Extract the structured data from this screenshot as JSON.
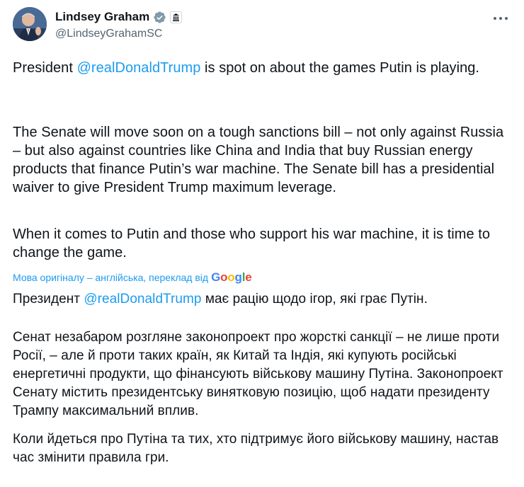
{
  "author": {
    "display_name": "Lindsey Graham",
    "handle": "@LindseyGrahamSC",
    "verified_icon": "verified-badge-icon",
    "affiliation_icon": "government-affiliation-icon"
  },
  "more_menu": {
    "icon": "more-options-icon"
  },
  "original": {
    "p1_before": "President ",
    "p1_mention": "@realDonaldTrump",
    "p1_after": " is spot on about the games Putin is playing.",
    "p2": "The Senate will move soon on a tough sanctions bill – not only against Russia – but also against countries like China and India that buy Russian energy products that finance Putin’s war machine. The Senate bill has a presidential waiver to give President Trump maximum leverage.",
    "p3": "When it comes to Putin and those who support his war machine, it is time to change the game."
  },
  "translation_note": {
    "label": "Мова оригіналу – англійська, переклад від",
    "provider": "Google"
  },
  "translated": {
    "p1_before": "Президент ",
    "p1_mention": "@realDonaldTrump",
    "p1_after": " має рацію щодо ігор, які грає Путін.",
    "p2": "Сенат незабаром розгляне законопроект про жорсткі санкції – не лише проти Росії, – але й проти таких країн, як Китай та Індія, які купують російські енергетичні продукти, що фінансують військову машину Путіна. Законопроект Сенату містить президентську винятковую позицію, щоб надати президенту Трампу максимальний вплив.",
    "p3": "Коли йдеться про Путіна та тих, хто підтримує його військову машину, настав час змінити правила гри."
  },
  "colors": {
    "text": "#0f1419",
    "secondary": "#536471",
    "link": "#1d9bf0",
    "verified": "#829aab"
  }
}
